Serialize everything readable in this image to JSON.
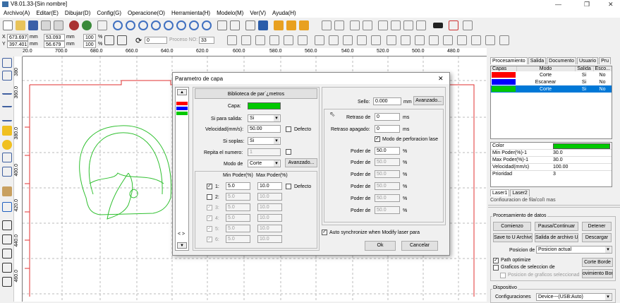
{
  "title": "V8.01.33-[Sin nombre]",
  "menu": [
    "Archivo(A)",
    "Editar(E)",
    "Dibujar(D)",
    "Config(G)",
    "Operacione(O)",
    "Herramienta(H)",
    "Modelo(M)",
    "Ver(V)",
    "Ayuda(H)"
  ],
  "coords": {
    "x_label": "X",
    "y_label": "Y",
    "x": "673.697",
    "y": "397.401",
    "unit": "mm",
    "w": "53.093",
    "h": "56.679",
    "pct1": "100",
    "pct2": "100",
    "pct_unit": "%",
    "angle": "0",
    "process_label": "Proceso NO:",
    "process_no": "33"
  },
  "ruler_h": [
    "20.0",
    "700.0",
    "680.0",
    "660.0",
    "640.0",
    "620.0",
    "600.0",
    "580.0",
    "560.0",
    "540.0",
    "520.0",
    "500.0",
    "480.0"
  ],
  "ruler_v": [
    "380",
    "360.0",
    "380.0",
    "400.0",
    "420.0",
    "440.0",
    "460.0"
  ],
  "right": {
    "tabs": [
      "Procesamiento",
      "Salida",
      "Documento",
      "Usuario",
      "Pru"
    ],
    "layer_headers": [
      "Capas",
      "Modo",
      "Salida",
      "Esco..."
    ],
    "layers": [
      {
        "color": "#ff0000",
        "mode": "Corte",
        "out": "Si",
        "esc": "No"
      },
      {
        "color": "#0000ff",
        "mode": "Escanear",
        "out": "Si",
        "esc": "No"
      },
      {
        "color": "#00c800",
        "mode": "Corte",
        "out": "Si",
        "esc": "No"
      }
    ],
    "props": [
      {
        "k": "Color",
        "v": ""
      },
      {
        "k": "Min Poder(%)-1",
        "v": "30.0"
      },
      {
        "k": "Max Poder(%)-1",
        "v": "30.0"
      },
      {
        "k": "Velocidad(mm/s)",
        "v": "100.00"
      },
      {
        "k": "Prioridad",
        "v": "3"
      }
    ],
    "laser_tabs": [
      "Laser1",
      "Laser2"
    ],
    "cut_text": "Configuracion de fila(col) mas",
    "data_title": "Procesamiento de datos",
    "btns": [
      "Comienzo",
      "Pausa/Continuar",
      "Detener",
      "Save to U Archivo",
      "Salida de archivo U",
      "Descargar"
    ],
    "pos_label": "Posicion de",
    "pos_value": "Posicion actual",
    "path_opt": "Path optimize",
    "graf": "Graficos de seleccion de",
    "pos_graf": "Posicion de graficos seleccionad",
    "corte_borde": "Corte Borde",
    "mov_borde": "ovimiento Bord",
    "device_title": "Dispositivo",
    "config_label": "Configuraciones",
    "device_value": "Device---(USB:Auto)"
  },
  "dialog": {
    "title": "Parametro de capa",
    "close": "✕",
    "lib_btn": "Biblioteca de par´¿metros",
    "capa_label": "Capa:",
    "capa_color": "#00c800",
    "salida_label": "Si para salida:",
    "salida_val": "Si",
    "vel_label": "Velocidad(mm/s):",
    "vel_val": "50.00",
    "defecto": "Defecto",
    "soplas_label": "Si soplas:",
    "soplas_val": "Si",
    "repita_label": "Repita el numero:",
    "repita_val": "1",
    "modo_label": "Modo de",
    "modo_val": "Corte",
    "avanzado": "Avanzado...",
    "min_hdr": "Min Poder(%)",
    "max_hdr": "Max Poder(%)",
    "powers": [
      {
        "n": "1:",
        "min": "5.0",
        "max": "10.0"
      },
      {
        "n": "2:",
        "min": "5.0",
        "max": "10.0"
      },
      {
        "n": "3:",
        "min": "5.0",
        "max": "10.0"
      },
      {
        "n": "4:",
        "min": "5.0",
        "max": "10.0"
      },
      {
        "n": "5:",
        "min": "5.0",
        "max": "10.0"
      },
      {
        "n": "6:",
        "min": "5.0",
        "max": "10.0"
      }
    ],
    "defecto2": "Defecto",
    "sello_label": "Sello:",
    "sello_val": "0.000",
    "mm": "mm",
    "avanzado2": "Avanzado...",
    "retraso_label": "Retraso de",
    "retraso_val": "0",
    "ms": "ms",
    "retraso_ap_label": "Retraso apagado:",
    "retraso_ap_val": "0",
    "perf_label": "Modo de perforacion lase",
    "poder_label": "Poder de",
    "poder_vals": [
      "50.0",
      "50.0",
      "50.0",
      "50.0",
      "50.0",
      "50.0"
    ],
    "pct": "%",
    "auto_sync": "Auto synchronize when Modify laser para",
    "ok": "Ok",
    "cancel": "Cancelar"
  }
}
